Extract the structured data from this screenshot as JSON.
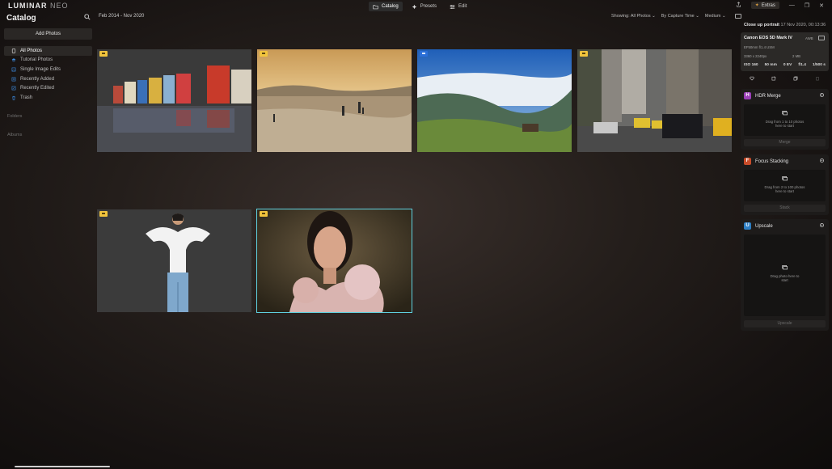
{
  "app": {
    "logo_main": "LUMINAR",
    "logo_sub": "NEO"
  },
  "topnav": [
    {
      "label": "Catalog",
      "icon": "folder-icon"
    },
    {
      "label": "Presets",
      "icon": "presets-icon"
    },
    {
      "label": "Edit",
      "icon": "sliders-icon"
    }
  ],
  "extras": {
    "label": "Extras"
  },
  "sidebar": {
    "title": "Catalog",
    "add_photos": "Add Photos",
    "items": [
      {
        "label": "All Photos",
        "icon": "photos-icon"
      },
      {
        "label": "Tutorial Photos",
        "icon": "graduation-cap-icon"
      },
      {
        "label": "Single Image Edits",
        "icon": "single-image-icon"
      },
      {
        "label": "Recently Added",
        "icon": "recently-added-icon"
      },
      {
        "label": "Recently Edited",
        "icon": "recently-edited-icon"
      },
      {
        "label": "Trash",
        "icon": "trash-icon"
      }
    ],
    "folders_label": "Folders",
    "albums_label": "Albums"
  },
  "toolbar": {
    "date_range": "Feb 2014 - Nov 2020",
    "showing": "Showing: All Photos ⌄",
    "sort": "By Capture Time ⌄",
    "size": "Medium ⌄"
  },
  "photos": [
    {
      "name": "Colorful houses reflection",
      "badge": "yellow"
    },
    {
      "name": "Beach at sunset",
      "badge": "yellow"
    },
    {
      "name": "Misty valley landscape",
      "badge": "blue"
    },
    {
      "name": "City street with taxis",
      "badge": "yellow"
    },
    {
      "name": "Woman in white shirt",
      "badge": "yellow"
    },
    {
      "name": "Close up portrait",
      "badge": "yellow",
      "selected": true
    }
  ],
  "info_panel": {
    "title": "Close up portrait",
    "date": "17 Nov 2020, 00:13:36",
    "camera": "Canon EOS 5D Mark IV",
    "wb": "AWB",
    "lens": "EF50mm f/1.4 USM",
    "resolution": "3360 x 2240px",
    "filesize": "2 MB",
    "iso": "ISO 160",
    "focal": "50 mm",
    "ev": "0 EV",
    "aperture": "f/1.4",
    "shutter": "1/500 s"
  },
  "tools": [
    {
      "title": "HDR Merge",
      "letter": "H",
      "color": "#9b3fb8",
      "drop_text": "Drag from 1 to 10 photos here to start",
      "button": "Merge"
    },
    {
      "title": "Focus Stacking",
      "letter": "F",
      "color": "#c84c2a",
      "drop_text": "Drag from 2 to 100 photos here to start",
      "button": "Stack"
    },
    {
      "title": "Upscale",
      "letter": "U",
      "color": "#2d7fc4",
      "drop_text": "Drag photo here to start",
      "button": "Upscale"
    }
  ]
}
